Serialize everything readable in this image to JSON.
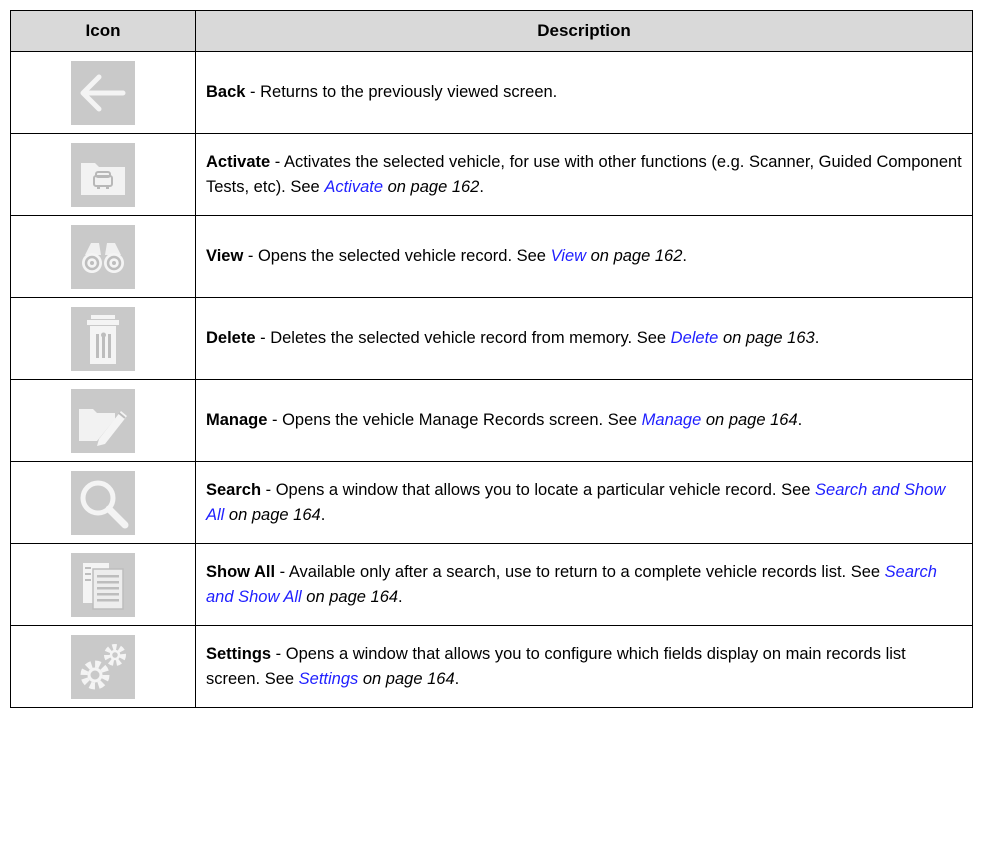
{
  "header": {
    "icon": "Icon",
    "description": "Description"
  },
  "rows": [
    {
      "icon": "back-arrow-icon",
      "name": "Back",
      "text": " - Returns to the previously viewed screen.",
      "see": "",
      "link": "",
      "page": "",
      "end": ""
    },
    {
      "icon": "vehicle-folder-icon",
      "name": "Activate",
      "text": " - Activates the selected vehicle, for use with other functions (e.g. Scanner, Guided Component Tests, etc). ",
      "see": "See ",
      "link": "Activate",
      "page": " on page 162",
      "end": "."
    },
    {
      "icon": "binoculars-icon",
      "name": "View",
      "text": " - Opens the selected vehicle record. ",
      "see": "See ",
      "link": "View",
      "page": " on page 162",
      "end": "."
    },
    {
      "icon": "trash-can-icon",
      "name": "Delete",
      "text": " - Deletes the selected vehicle record from memory. ",
      "see": "See ",
      "link": "Delete",
      "page": " on page 163",
      "end": "."
    },
    {
      "icon": "folder-pencil-icon",
      "name": "Manage",
      "text": " - Opens the vehicle Manage Records screen. ",
      "see": "See ",
      "link": "Manage",
      "page": " on page 164",
      "end": "."
    },
    {
      "icon": "magnifier-icon",
      "name": "Search",
      "text": " - Opens a window that allows you to locate a particular vehicle record. ",
      "see": "See ",
      "link": "Search and Show All",
      "page": " on page 164",
      "end": "."
    },
    {
      "icon": "document-list-icon",
      "name": "Show All",
      "text": " - Available only after a search, use to return to a complete vehicle records list. ",
      "see": "See ",
      "link": "Search and Show All",
      "page": " on page 164",
      "end": "."
    },
    {
      "icon": "gears-icon",
      "name": "Settings",
      "text": " - Opens a window that allows you to configure which fields display on main records list screen. ",
      "see": "See ",
      "link": "Settings",
      "page": " on page 164",
      "end": "."
    }
  ]
}
